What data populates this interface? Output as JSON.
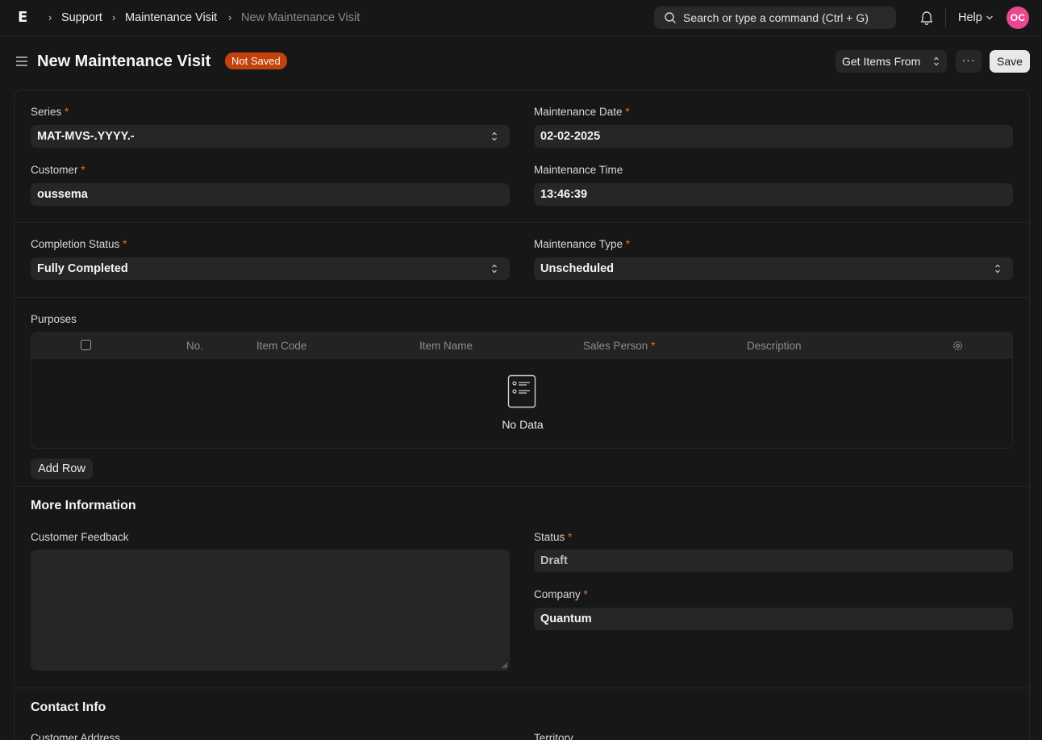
{
  "navbar": {
    "logo_letter": "E",
    "breadcrumbs": [
      "Support",
      "Maintenance Visit",
      "New Maintenance Visit"
    ],
    "search_placeholder": "Search or type a command (Ctrl + G)",
    "help_label": "Help",
    "avatar_initials": "OC"
  },
  "page": {
    "title": "New Maintenance Visit",
    "status_badge": "Not Saved",
    "get_items_label": "Get Items From",
    "more_label": "···",
    "save_label": "Save"
  },
  "form": {
    "series": {
      "label": "Series",
      "value": "MAT-MVS-.YYYY.-"
    },
    "maintenance_date": {
      "label": "Maintenance Date",
      "value": "02-02-2025"
    },
    "customer": {
      "label": "Customer",
      "value": "oussema"
    },
    "maintenance_time": {
      "label": "Maintenance Time",
      "value": "13:46:39"
    },
    "completion_status": {
      "label": "Completion Status",
      "value": "Fully Completed"
    },
    "maintenance_type": {
      "label": "Maintenance Type",
      "value": "Unscheduled"
    },
    "required_mark": "*"
  },
  "purposes": {
    "label": "Purposes",
    "columns": [
      "No.",
      "Item Code",
      "Item Name",
      "Sales Person",
      "Description"
    ],
    "empty_text": "No Data",
    "add_row_label": "Add Row"
  },
  "more_info": {
    "title": "More Information",
    "customer_feedback_label": "Customer Feedback",
    "status": {
      "label": "Status",
      "value": "Draft"
    },
    "company": {
      "label": "Company",
      "value": "Quantum"
    }
  },
  "contact_info": {
    "title": "Contact Info",
    "customer_address_label": "Customer Address",
    "territory_label": "Territory"
  },
  "colors": {
    "background": "#171717",
    "input_bg": "#262626",
    "badge": "#c2410c",
    "required": "#e0702e",
    "avatar": "#e8488f"
  }
}
